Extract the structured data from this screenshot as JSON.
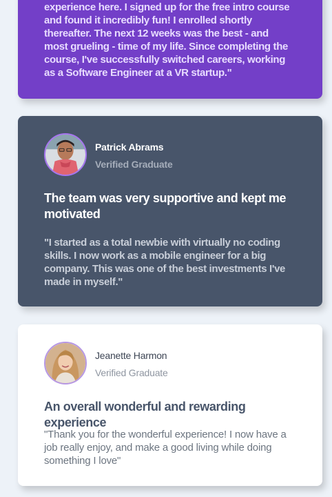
{
  "testimonials": [
    {
      "quote": "experience here. I signed up for the free intro course and found it incredibly fun! I enrolled shortly thereafter. The next 12 weeks was the best - and most grueling - time of my life. Since completing the course, I've successfully switched careers, working as a Software Engineer at a VR startup.\"",
      "background": "#733fc8"
    },
    {
      "name": "Patrick Abrams",
      "role": "Verified Graduate",
      "headline": "The team was very supportive and kept me motivated",
      "quote": "\"I started as a total newbie with virtually no coding skills. I now work as a mobile engineer for a big company. This was one of the best investments I've made in myself.\"",
      "background": "#48556a",
      "avatar_border": "#a775f1"
    },
    {
      "name": "Jeanette Harmon",
      "role": "Verified Graduate",
      "headline": "An overall wonderful and rewarding experience",
      "quote": "\"Thank you for the wonderful experience! I now have a job really enjoy, and make a good living while doing something I love\"",
      "background": "#ffffff",
      "avatar_border": "#b697e4"
    }
  ],
  "page_background": "#edf2f8"
}
